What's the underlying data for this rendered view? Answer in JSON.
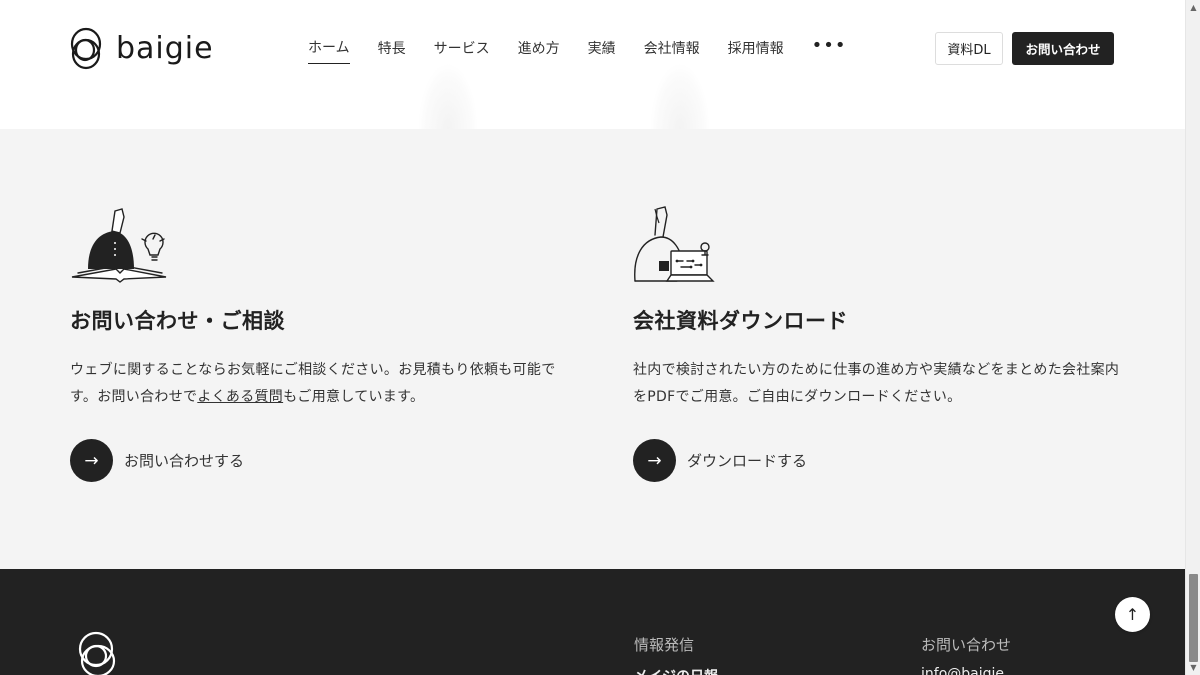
{
  "header": {
    "logo_text": "baigie",
    "nav": [
      {
        "label": "ホーム",
        "active": true
      },
      {
        "label": "特長"
      },
      {
        "label": "サービス"
      },
      {
        "label": "進め方"
      },
      {
        "label": "実績"
      },
      {
        "label": "会社情報"
      },
      {
        "label": "採用情報"
      }
    ],
    "more_label": "•••",
    "download_label": "資料DL",
    "contact_label": "お問い合わせ"
  },
  "contact_card": {
    "title": "お問い合わせ・ご相談",
    "desc_before": "ウェブに関することならお気軽にご相談ください。お見積もり依頼も可能です。お問い合わせで",
    "desc_link": "よくある質問",
    "desc_after": "もご用意しています。",
    "cta_label": "お問い合わせする",
    "cta_icon": "arrow-right-icon"
  },
  "download_card": {
    "title": "会社資料ダウンロード",
    "desc": "社内で検討されたい方のために仕事の進め方や実績などをまとめた会社案内をPDFでご用意。ご自由にダウンロードください。",
    "cta_label": "ダウンロードする",
    "cta_icon": "arrow-right-icon"
  },
  "footer": {
    "col1_title": "情報発信",
    "col1_first": "メイジの日報",
    "col2_title": "お問い合わせ",
    "col2_first": "info@baigie",
    "to_top_icon": "arrow-up-icon"
  },
  "colors": {
    "dark": "#222222",
    "section_bg": "#f4f4f4",
    "header_bg": "#ffffff"
  }
}
